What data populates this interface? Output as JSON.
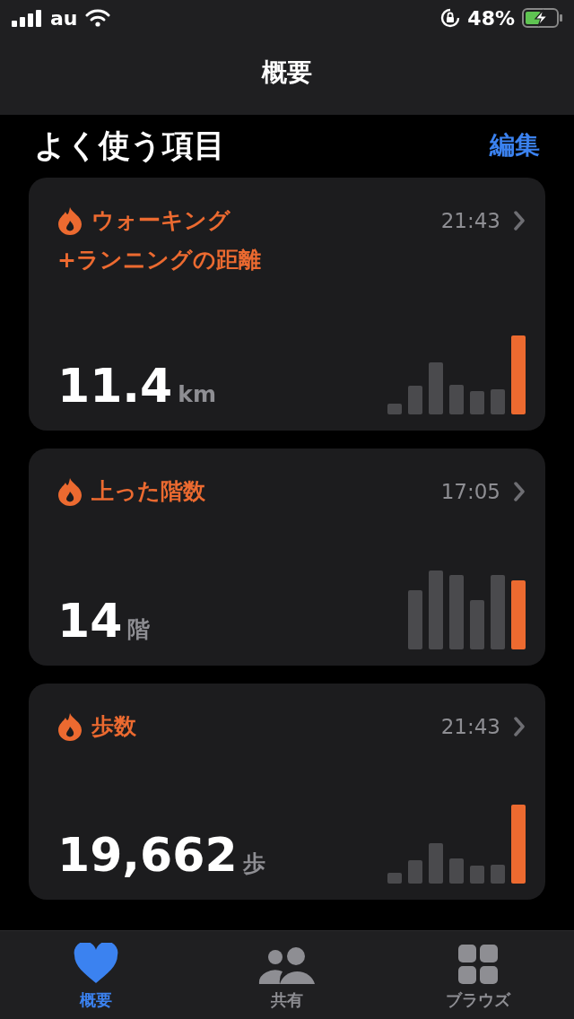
{
  "status_bar": {
    "carrier": "au",
    "battery_percent": "48%"
  },
  "nav_bar": {
    "title": "概要"
  },
  "section": {
    "title": "よく使う項目",
    "edit_link": "編集"
  },
  "cards": [
    {
      "title_lines": [
        "ウォーキング",
        "+ランニングの距離"
      ],
      "time": "21:43",
      "value": "11.4",
      "unit": "km"
    },
    {
      "title_lines": [
        "上った階数"
      ],
      "time": "17:05",
      "value": "14",
      "unit": "階"
    },
    {
      "title_lines": [
        "歩数"
      ],
      "time": "21:43",
      "value": "19,662",
      "unit": "歩"
    }
  ],
  "tab_bar": [
    {
      "label": "概要",
      "selected": true
    },
    {
      "label": "共有",
      "selected": false
    },
    {
      "label": "ブラウズ",
      "selected": false
    }
  ]
}
